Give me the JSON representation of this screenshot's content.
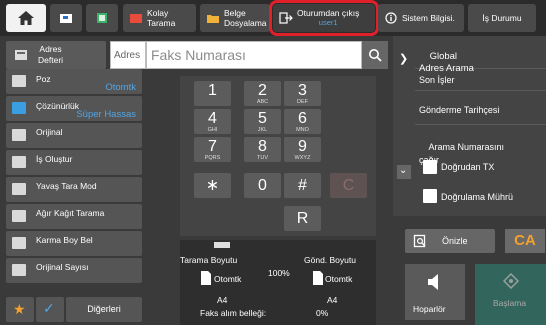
{
  "topbar": {
    "kolay_tarama": "Kolay\nTarama",
    "belge_dosyalama": "Belge\nDosyalama",
    "logout_label": "Oturumdan çıkış",
    "logout_user": "user1",
    "sistem_bilgisi": "Sistem Bilgisi.",
    "is_durumu": "İş Durumu"
  },
  "address": {
    "defteri": "Adres\nDefteri",
    "adres_label": "Adres",
    "placeholder": "Faks Numarası"
  },
  "left": {
    "poz": "Poz",
    "poz_value": "Otomtk",
    "cozunurluk": "Çözünürlük",
    "cozunurluk_value": "Süper Hassas",
    "orijinal": "Orijinal",
    "is_olustur": "İş Oluştur",
    "yavas_tara": "Yavaş Tara Mod",
    "agir_kagit": "Ağır Kağıt Tarama",
    "karma_boy": "Karma Boy Bel",
    "orijinal_sayisi": "Orijinal Sayısı",
    "digerleri": "Diğerleri"
  },
  "keypad": {
    "k1": "1",
    "k2": "2",
    "k2s": "ABC",
    "k3": "3",
    "k3s": "DEF",
    "k4": "4",
    "k4s": "GHI",
    "k5": "5",
    "k5s": "JKL",
    "k6": "6",
    "k6s": "MNO",
    "k7": "7",
    "k7s": "PQRS",
    "k8": "8",
    "k8s": "TUV",
    "k9": "9",
    "k9s": "WXYZ",
    "kstar": "∗",
    "k0": "0",
    "khash": "#",
    "kc": "C",
    "kr": "R"
  },
  "status": {
    "tarama_boyutu": "Tarama Boyutu",
    "gond_boyutu": "Gönd. Boyutu",
    "left_val": "Otomtk",
    "pct": "100%",
    "right_val": "Otomtk",
    "left_size": "A4",
    "right_size": "A4",
    "faks_bellek": "Faks alım belleği:",
    "faks_pct": "0%"
  },
  "right": {
    "global": "Global\nAdres Arama",
    "son_isler": "Son İşler",
    "gonderme": "Gönderme Tarihçesi",
    "arama_num": "Arama Numarasını\nçağır",
    "dogrudan": "Doğrudan TX",
    "dogrulama": "Doğrulama Mührü",
    "onizle": "Önizle",
    "ca": "CA",
    "hoparlor": "Hoparlör",
    "baslama": "Başlama"
  }
}
